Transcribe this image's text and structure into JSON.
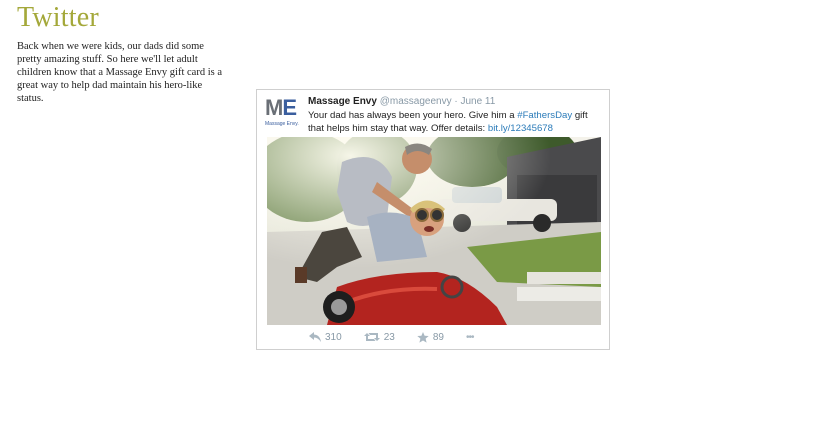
{
  "slide": {
    "title": "Twitter",
    "body": "Back when we were kids, our dads did some pretty amazing stuff. So here we'll let adult children know that a Massage Envy gift card is a great way to help dad maintain his hero-like status."
  },
  "tweet": {
    "logo_text": "Massage Envy.",
    "author_name": "Massage Envy",
    "handle": "@massageenvy",
    "separator": " · ",
    "date": "June 11",
    "text_part1": "Your dad has always been your hero. Give him a ",
    "hashtag": "#FathersDay",
    "text_part2": " gift that helps him stay that way. Offer details: ",
    "link": "bit.ly/12345678",
    "reply_count": "310",
    "retweet_count": "23",
    "favorite_count": "89",
    "more": "•••"
  },
  "colors": {
    "title": "#a4a83a",
    "link": "#2b7bb9",
    "muted": "#8899a6",
    "brand_blue": "#3a5e9e"
  },
  "icons": [
    "reply-icon",
    "retweet-icon",
    "star-icon",
    "more-icon"
  ]
}
